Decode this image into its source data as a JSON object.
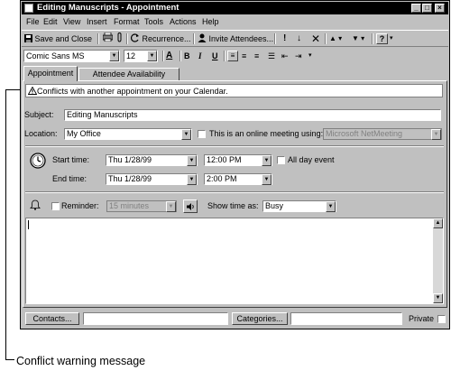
{
  "window": {
    "title": "Editing Manuscripts - Appointment",
    "buttons": [
      "_",
      "□",
      "×"
    ]
  },
  "menubar": {
    "items": [
      "File",
      "Edit",
      "View",
      "Insert",
      "Format",
      "Tools",
      "Actions",
      "Help"
    ]
  },
  "toolbar": {
    "save_close_label": "Save and Close",
    "recurrence_label": "Recurrence...",
    "invite_label": "Invite Attendees..."
  },
  "formatting": {
    "font": "Comic Sans MS",
    "size": "12"
  },
  "tabs": [
    "Appointment",
    "Attendee Availability"
  ],
  "conflict": {
    "message": "Conflicts with another appointment on your Calendar."
  },
  "form": {
    "subject_label": "Subject:",
    "subject_value": "Editing Manuscripts",
    "location_label": "Location:",
    "location_value": "My Office",
    "online_label": "This is an online meeting using:",
    "online_value": "Microsoft NetMeeting",
    "start_label": "Start time:",
    "start_date": "Thu 1/28/99",
    "start_time": "12:00 PM",
    "allday_label": "All day event",
    "end_label": "End time:",
    "end_date": "Thu 1/28/99",
    "end_time": "2:00 PM",
    "reminder_label": "Reminder:",
    "reminder_value": "15 minutes",
    "showtime_label": "Show time as:",
    "showtime_value": "Busy"
  },
  "footer": {
    "contacts_label": "Contacts...",
    "categories_label": "Categories...",
    "private_label": "Private"
  },
  "callout": {
    "text": "Conflict warning message"
  }
}
